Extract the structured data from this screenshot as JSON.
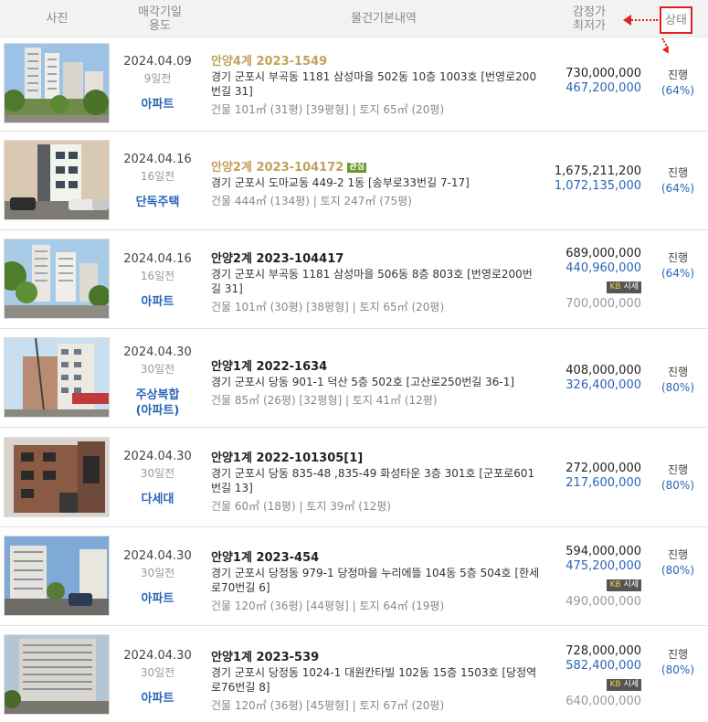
{
  "header": {
    "photo": "사진",
    "date_line1": "매각기일",
    "date_line2": "용도",
    "info": "물건기본내역",
    "price_line1": "감정가",
    "price_line2": "최저가",
    "status": "상태"
  },
  "rows": [
    {
      "date": "2024.04.09",
      "ago": "9일전",
      "usage": "아파트",
      "case": "안양4계 2023-1549",
      "address": "경기 군포시 부곡동 1181 삼성마을 502동 10층 1003호 [번영로200번길 31]",
      "area": "건물 101㎡ (31평) [39평형]  |  토지 65㎡ (20평)",
      "appraisal": "730,000,000",
      "minimum": "467,200,000",
      "status": "진행",
      "percent": "(64%)"
    },
    {
      "date": "2024.04.16",
      "ago": "16일전",
      "usage": "단독주택",
      "case": "안양2계 2023-104172",
      "badge": "관심",
      "address": "경기 군포시 도마교동 449-2 1동 [송부로33번길 7-17]",
      "area": "건물 444㎡ (134평)  |  토지 247㎡ (75평)",
      "appraisal": "1,675,211,200",
      "minimum": "1,072,135,000",
      "status": "진행",
      "percent": "(64%)"
    },
    {
      "date": "2024.04.16",
      "ago": "16일전",
      "usage": "아파트",
      "case": "안양2계 2023-104417",
      "address": "경기 군포시 부곡동 1181 삼성마을 506동 8층 803호 [번영로200번길 31]",
      "area": "건물 101㎡ (30평) [38평형]  |  토지 65㎡ (20평)",
      "appraisal": "689,000,000",
      "minimum": "440,960,000",
      "kb_label": "KB",
      "kb_text": "시세",
      "kb_value": "700,000,000",
      "status": "진행",
      "percent": "(64%)"
    },
    {
      "date": "2024.04.30",
      "ago": "30일전",
      "usage": "주상복합",
      "usage2": "(아파트)",
      "case": "안양1계 2022-1634",
      "address": "경기 군포시 당동 901-1 덕산 5층 502호 [고산로250번길 36-1]",
      "area": "건물 85㎡ (26평) [32평형]  |  토지 41㎡ (12평)",
      "appraisal": "408,000,000",
      "minimum": "326,400,000",
      "status": "진행",
      "percent": "(80%)"
    },
    {
      "date": "2024.04.30",
      "ago": "30일전",
      "usage": "다세대",
      "case": "안양1계 2022-101305[1]",
      "address": "경기 군포시 당동 835-48 ,835-49 화성타운 3층 301호 [군포로601번길 13]",
      "area": "건물 60㎡ (18평)  |  토지 39㎡ (12평)",
      "appraisal": "272,000,000",
      "minimum": "217,600,000",
      "status": "진행",
      "percent": "(80%)"
    },
    {
      "date": "2024.04.30",
      "ago": "30일전",
      "usage": "아파트",
      "case": "안양1계 2023-454",
      "address": "경기 군포시 당정동 979-1 당정마을 누리에뜰 104동 5층 504호 [한세로70번길 6]",
      "area": "건물 120㎡ (36평) [44평형]  |  토지 64㎡ (19평)",
      "appraisal": "594,000,000",
      "minimum": "475,200,000",
      "kb_label": "KB",
      "kb_text": "시세",
      "kb_value": "490,000,000",
      "status": "진행",
      "percent": "(80%)"
    },
    {
      "date": "2024.04.30",
      "ago": "30일전",
      "usage": "아파트",
      "case": "안양1계 2023-539",
      "address": "경기 군포시 당정동 1024-1 대원칸타빌 102동 15층 1503호 [당정역로76번길 8]",
      "area": "건물 120㎡ (36평) [45평형]  |  토지 67㎡ (20평)",
      "appraisal": "728,000,000",
      "minimum": "582,400,000",
      "kb_label": "KB",
      "kb_text": "시세",
      "kb_value": "640,000,000",
      "status": "진행",
      "percent": "(80%)"
    }
  ],
  "colors": {
    "accent_blue": "#2a65b8",
    "highlight_red": "#e0211e",
    "gold_case": "#c3a15a"
  }
}
